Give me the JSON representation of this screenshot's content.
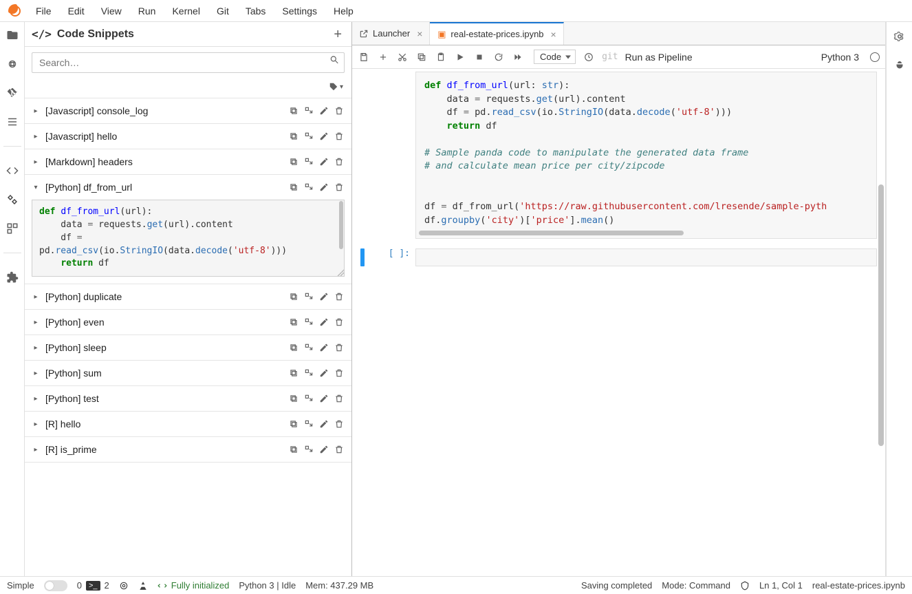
{
  "menu": [
    "File",
    "Edit",
    "View",
    "Run",
    "Kernel",
    "Git",
    "Tabs",
    "Settings",
    "Help"
  ],
  "sidebar": {
    "title": "Code Snippets",
    "search_placeholder": "Search…",
    "snippets": [
      {
        "label": "[Javascript] console_log",
        "expanded": false
      },
      {
        "label": "[Javascript] hello",
        "expanded": false
      },
      {
        "label": "[Markdown] headers",
        "expanded": false
      },
      {
        "label": "[Python] df_from_url",
        "expanded": true
      },
      {
        "label": "[Python] duplicate",
        "expanded": false
      },
      {
        "label": "[Python] even",
        "expanded": false
      },
      {
        "label": "[Python] sleep",
        "expanded": false
      },
      {
        "label": "[Python] sum",
        "expanded": false
      },
      {
        "label": "[Python] test",
        "expanded": false
      },
      {
        "label": "[R] hello",
        "expanded": false
      },
      {
        "label": "[R] is_prime",
        "expanded": false
      }
    ]
  },
  "tabs": [
    {
      "label": "Launcher",
      "active": false
    },
    {
      "label": "real-estate-prices.ipynb",
      "active": true
    }
  ],
  "toolbar": {
    "celltype": "Code",
    "run_pipeline": "Run as Pipeline",
    "kernel": "Python 3"
  },
  "empty_prompt": "[ ]:",
  "status": {
    "simple": "Simple",
    "tabs_count": "0",
    "terms_count": "2",
    "init": "Fully initialized",
    "kernel": "Python 3 | Idle",
    "mem": "Mem: 437.29 MB",
    "saving": "Saving completed",
    "mode": "Mode: Command",
    "cursor": "Ln 1, Col 1",
    "file": "real-estate-prices.ipynb"
  }
}
